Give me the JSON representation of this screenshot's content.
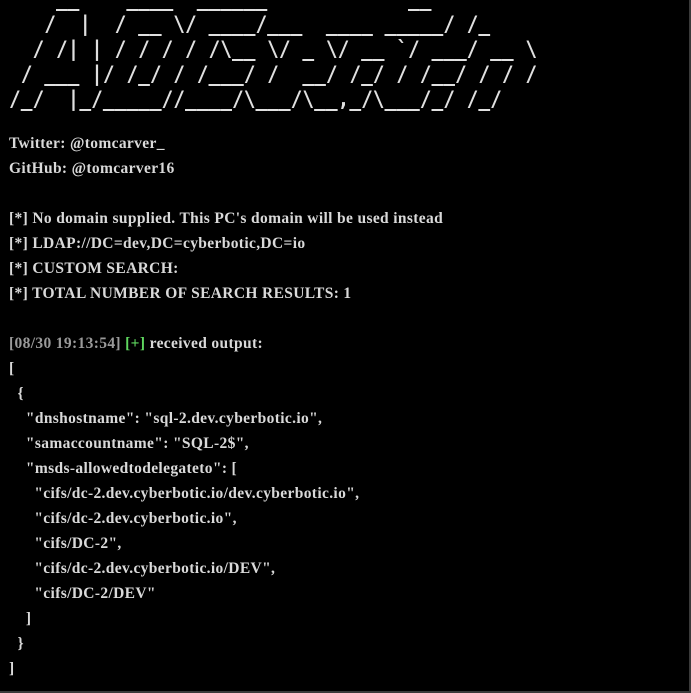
{
  "terminal": {
    "banner_lines": [
      "    __    ____  ______            __",
      "   /  |  / __ \\/ ____/___  ____ _____/ /_",
      "  / /| | / / / / /\\__ \\/ _ \\/ __ `/ ___/ __ \\",
      " / ___ |/ /_/ / /___/ /  __/ /_/ / /__/ / / /",
      "/_/  |_/_____//____/\\___/\\__,_/\\___/_/ /_/"
    ],
    "twitter": "Twitter: @tomcarver_",
    "github": "GitHub: @tomcarver16",
    "messages": [
      "[*] No domain supplied. This PC's domain will be used instead",
      "[*] LDAP://DC=dev,DC=cyberbotic,DC=io",
      "[*] CUSTOM SEARCH:",
      "[*] TOTAL NUMBER OF SEARCH RESULTS: 1"
    ],
    "received": {
      "timestamp": "[08/30 19:13:54]",
      "marker": "[+]",
      "text": " received output:"
    },
    "output_lines": [
      "[",
      "  {",
      "    \"dnshostname\": \"sql-2.dev.cyberbotic.io\",",
      "    \"samaccountname\": \"SQL-2$\",",
      "    \"msds-allowedtodelegateto\": [",
      "      \"cifs/dc-2.dev.cyberbotic.io/dev.cyberbotic.io\",",
      "      \"cifs/dc-2.dev.cyberbotic.io\",",
      "      \"cifs/DC-2\",",
      "      \"cifs/dc-2.dev.cyberbotic.io/DEV\",",
      "      \"cifs/DC-2/DEV\"",
      "    ]",
      "  }",
      "]"
    ]
  }
}
